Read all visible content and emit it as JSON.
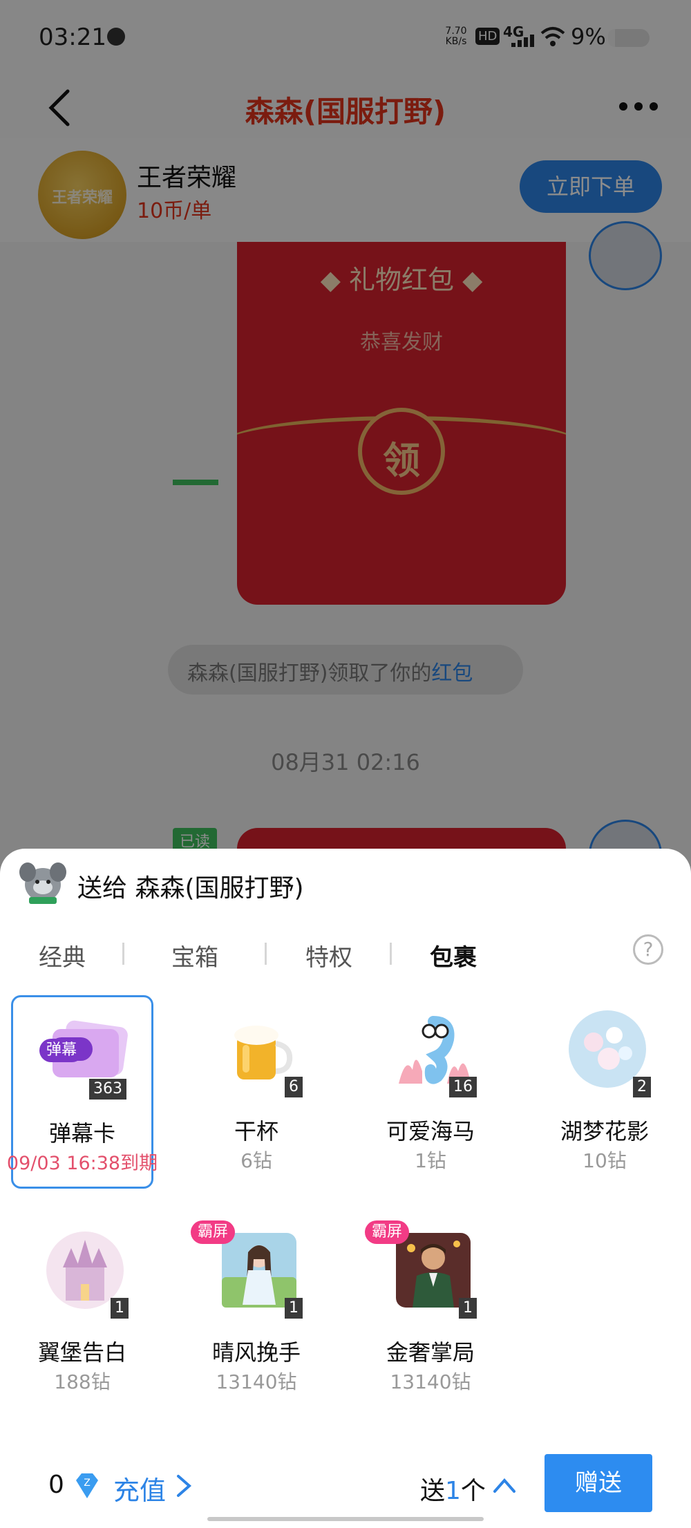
{
  "status_bar": {
    "time": "03:21",
    "net_speed_value": "7.70",
    "net_speed_unit": "KB/s",
    "hd": "HD",
    "network": "4G",
    "battery": "9%"
  },
  "nav": {
    "title": "森森(国服打野)"
  },
  "game_card": {
    "logo_text": "王者荣耀",
    "name": "王者荣耀",
    "price": "10币/单",
    "order_button": "立即下单"
  },
  "chat": {
    "red_packet_title": "◆ 礼物红包 ◆",
    "red_packet_subtitle": "恭喜发财",
    "red_packet_button": "领",
    "notice_prefix": "森森(国服打野)领取了你的",
    "notice_link": "红包",
    "timestamp": "08月31 02:16",
    "read_badge": "已读"
  },
  "sheet": {
    "title": "送给 森森(国服打野)",
    "tabs": [
      {
        "label": "经典"
      },
      {
        "label": "宝箱"
      },
      {
        "label": "特权"
      },
      {
        "label": "包裹"
      }
    ],
    "active_tab": "包裹",
    "help_label": "?",
    "gifts": [
      {
        "name": "弹幕卡",
        "count": "363",
        "sub": "09/03 16:38到期",
        "badge": "弹幕",
        "selected": true
      },
      {
        "name": "干杯",
        "count": "6",
        "sub": "6钻"
      },
      {
        "name": "可爱海马",
        "count": "16",
        "sub": "1钻"
      },
      {
        "name": "湖梦花影",
        "count": "2",
        "sub": "10钻"
      },
      {
        "name": "翼堡告白",
        "count": "1",
        "sub": "188钻"
      },
      {
        "name": "晴风挽手",
        "count": "1",
        "sub": "13140钻",
        "tag": "霸屏"
      },
      {
        "name": "金奢掌局",
        "count": "1",
        "sub": "13140钻",
        "tag": "霸屏"
      }
    ]
  },
  "footer": {
    "balance": "0",
    "recharge": "充值",
    "send_prefix": "送",
    "send_count": "1",
    "send_suffix": "个",
    "give_button": "赠送"
  },
  "colors": {
    "accent": "#2d84e6",
    "title_red": "#e0341d",
    "expire_pink": "#e3506c",
    "tag_pink": "#f23b85"
  }
}
